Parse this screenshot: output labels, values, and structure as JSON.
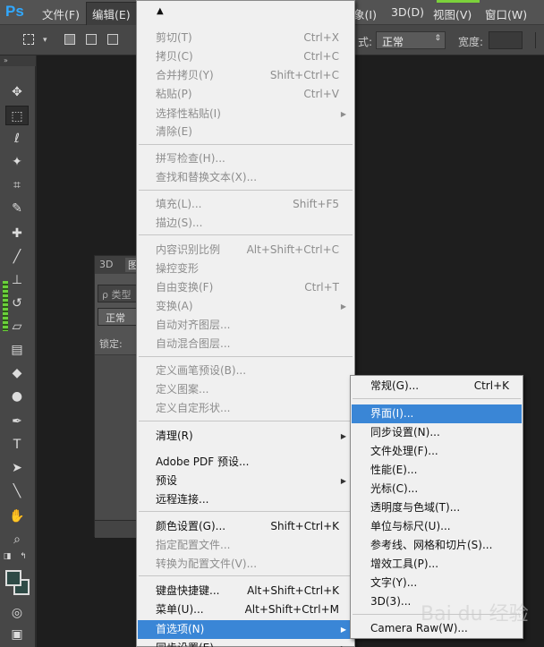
{
  "app": {
    "logo": "Ps"
  },
  "menubar": {
    "items": [
      {
        "label": "文件(F)"
      },
      {
        "label": "编辑(E)"
      },
      {
        "label": "象(I)"
      },
      {
        "label": "3D(D)"
      },
      {
        "label": "视图(V)"
      },
      {
        "label": "窗口(W)"
      }
    ]
  },
  "options": {
    "style_label": "式:",
    "style_value": "正常",
    "width_label": "宽度:"
  },
  "layers_panel": {
    "tabs": [
      "3D",
      "图"
    ],
    "search_placeholder": "ρ 类型",
    "blend_mode": "正常",
    "lock_label": "锁定:"
  },
  "edit_menu": {
    "items": [
      {
        "label": "剪切(T)",
        "shortcut": "Ctrl+X",
        "disabled": true
      },
      {
        "label": "拷贝(C)",
        "shortcut": "Ctrl+C",
        "disabled": true
      },
      {
        "label": "合并拷贝(Y)",
        "shortcut": "Shift+Ctrl+C",
        "disabled": true
      },
      {
        "label": "粘贴(P)",
        "shortcut": "Ctrl+V",
        "disabled": true
      },
      {
        "label": "选择性粘贴(I)",
        "shortcut": "",
        "disabled": true,
        "submenu": true
      },
      {
        "label": "清除(E)",
        "shortcut": "",
        "disabled": true
      },
      {
        "label": "拼写检查(H)...",
        "shortcut": "",
        "disabled": true
      },
      {
        "label": "查找和替换文本(X)...",
        "shortcut": "",
        "disabled": true
      },
      {
        "label": "填充(L)...",
        "shortcut": "Shift+F5",
        "disabled": true
      },
      {
        "label": "描边(S)...",
        "shortcut": "",
        "disabled": true
      },
      {
        "label": "内容识别比例",
        "shortcut": "Alt+Shift+Ctrl+C",
        "disabled": true
      },
      {
        "label": "操控变形",
        "shortcut": "",
        "disabled": true
      },
      {
        "label": "自由变换(F)",
        "shortcut": "Ctrl+T",
        "disabled": true
      },
      {
        "label": "变换(A)",
        "shortcut": "",
        "disabled": true,
        "submenu": true
      },
      {
        "label": "自动对齐图层...",
        "shortcut": "",
        "disabled": true
      },
      {
        "label": "自动混合图层...",
        "shortcut": "",
        "disabled": true
      },
      {
        "label": "定义画笔预设(B)...",
        "shortcut": "",
        "disabled": true
      },
      {
        "label": "定义图案...",
        "shortcut": "",
        "disabled": true
      },
      {
        "label": "定义自定形状...",
        "shortcut": "",
        "disabled": true
      },
      {
        "label": "清理(R)",
        "shortcut": "",
        "disabled": false,
        "submenu": true
      },
      {
        "label": "Adobe PDF 预设...",
        "shortcut": "",
        "disabled": false
      },
      {
        "label": "预设",
        "shortcut": "",
        "disabled": false,
        "submenu": true
      },
      {
        "label": "远程连接...",
        "shortcut": "",
        "disabled": false
      },
      {
        "label": "颜色设置(G)...",
        "shortcut": "Shift+Ctrl+K",
        "disabled": false
      },
      {
        "label": "指定配置文件...",
        "shortcut": "",
        "disabled": true
      },
      {
        "label": "转换为配置文件(V)...",
        "shortcut": "",
        "disabled": true
      },
      {
        "label": "键盘快捷键...",
        "shortcut": "Alt+Shift+Ctrl+K",
        "disabled": false
      },
      {
        "label": "菜单(U)...",
        "shortcut": "Alt+Shift+Ctrl+M",
        "disabled": false
      },
      {
        "label": "首选项(N)",
        "shortcut": "",
        "disabled": false,
        "submenu": true,
        "highlighted": true
      },
      {
        "label": "同步设置(E)",
        "shortcut": "",
        "disabled": false,
        "submenu": true
      }
    ]
  },
  "pref_menu": {
    "items": [
      {
        "label": "常规(G)...",
        "shortcut": "Ctrl+K"
      },
      {
        "label": "界面(I)...",
        "shortcut": "",
        "highlighted": true
      },
      {
        "label": "同步设置(N)...",
        "shortcut": ""
      },
      {
        "label": "文件处理(F)...",
        "shortcut": ""
      },
      {
        "label": "性能(E)...",
        "shortcut": ""
      },
      {
        "label": "光标(C)...",
        "shortcut": ""
      },
      {
        "label": "透明度与色域(T)...",
        "shortcut": ""
      },
      {
        "label": "单位与标尺(U)...",
        "shortcut": ""
      },
      {
        "label": "参考线、网格和切片(S)...",
        "shortcut": ""
      },
      {
        "label": "增效工具(P)...",
        "shortcut": ""
      },
      {
        "label": "文字(Y)...",
        "shortcut": ""
      },
      {
        "label": "3D(3)...",
        "shortcut": ""
      },
      {
        "label": "Camera Raw(W)...",
        "shortcut": ""
      }
    ]
  },
  "watermark": "Bai du 经验",
  "colors": {
    "menu_bg": "#f0f0f0",
    "highlight": "#3a86d6",
    "disabled_text": "#8d8d8d"
  }
}
